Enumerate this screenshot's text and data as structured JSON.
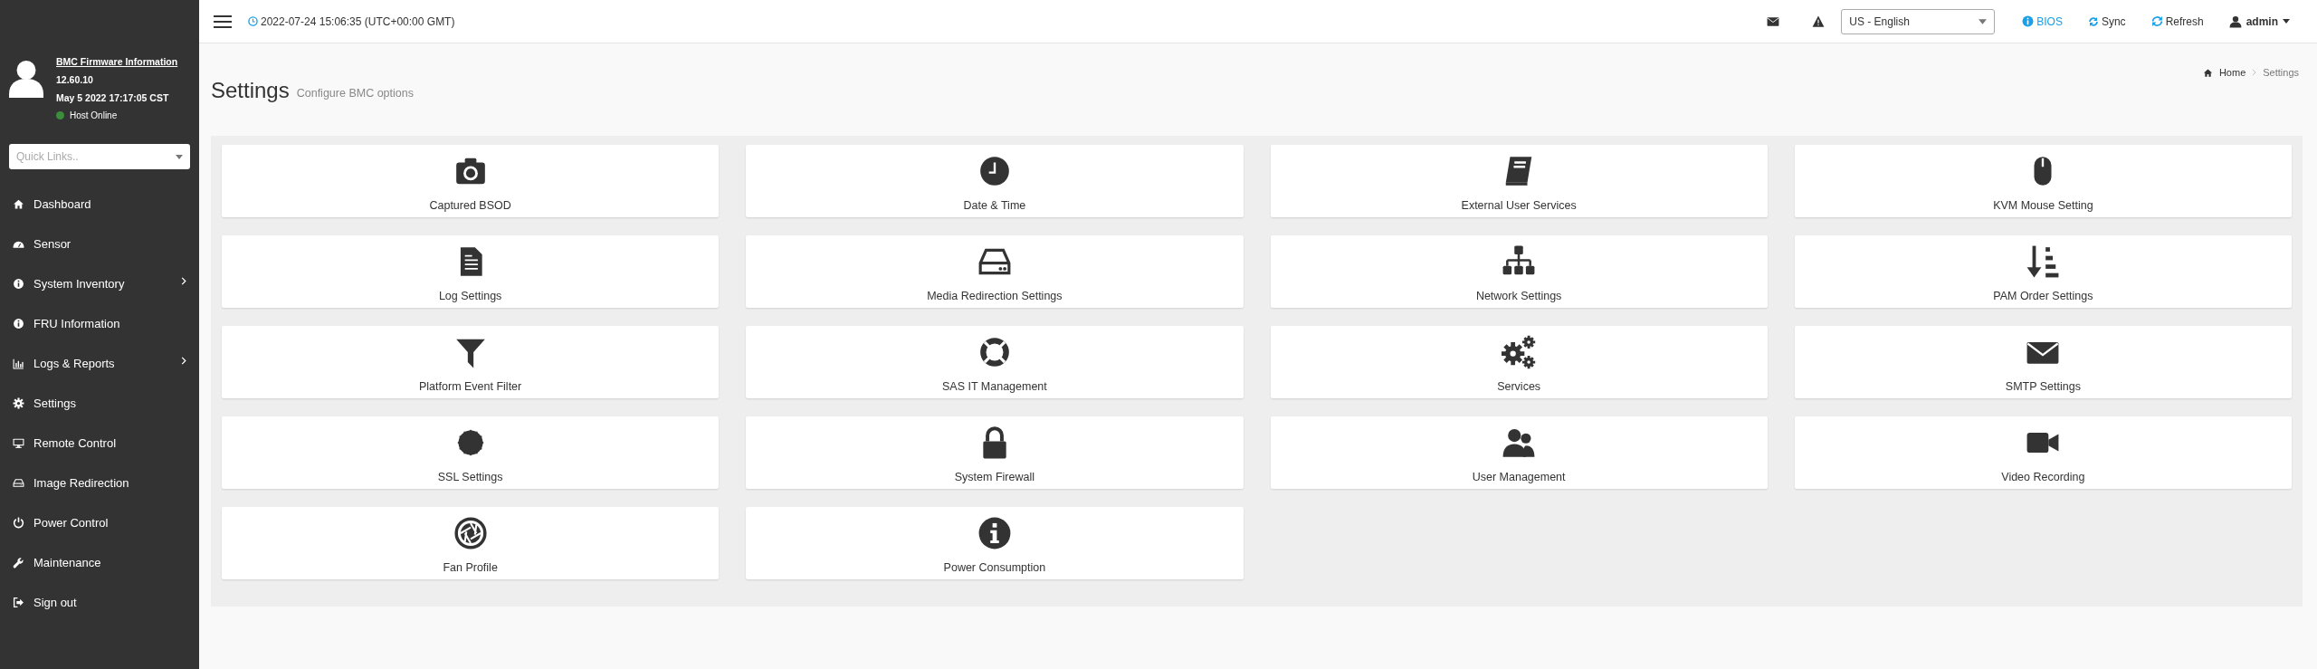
{
  "sidebar": {
    "firmware_link": "BMC Firmware Information",
    "version": "12.60.10",
    "build_date": "May 5 2022 17:17:05 CST",
    "host_status": {
      "label": "Host Online",
      "online": true
    },
    "quick_links": {
      "placeholder": "Quick Links.."
    },
    "items": [
      {
        "label": "Dashboard",
        "has_submenu": false
      },
      {
        "label": "Sensor",
        "has_submenu": false
      },
      {
        "label": "System Inventory",
        "has_submenu": true
      },
      {
        "label": "FRU Information",
        "has_submenu": false
      },
      {
        "label": "Logs & Reports",
        "has_submenu": true
      },
      {
        "label": "Settings",
        "has_submenu": false
      },
      {
        "label": "Remote Control",
        "has_submenu": false
      },
      {
        "label": "Image Redirection",
        "has_submenu": false
      },
      {
        "label": "Power Control",
        "has_submenu": false
      },
      {
        "label": "Maintenance",
        "has_submenu": false
      },
      {
        "label": "Sign out",
        "has_submenu": false
      }
    ]
  },
  "topbar": {
    "datetime": "2022-07-24 15:06:35 (UTC+00:00 GMT)",
    "language": "US - English",
    "bios": "BIOS",
    "sync": "Sync",
    "refresh": "Refresh",
    "user": "admin"
  },
  "page": {
    "title": "Settings",
    "subtitle": "Configure BMC options",
    "breadcrumb": [
      "Home",
      "Settings"
    ]
  },
  "cards": [
    {
      "label": "Captured BSOD"
    },
    {
      "label": "Date & Time"
    },
    {
      "label": "External User Services"
    },
    {
      "label": "KVM Mouse Setting"
    },
    {
      "label": "Log Settings"
    },
    {
      "label": "Media Redirection Settings"
    },
    {
      "label": "Network Settings"
    },
    {
      "label": "PAM Order Settings"
    },
    {
      "label": "Platform Event Filter"
    },
    {
      "label": "SAS IT Management"
    },
    {
      "label": "Services"
    },
    {
      "label": "SMTP Settings"
    },
    {
      "label": "SSL Settings"
    },
    {
      "label": "System Firewall"
    },
    {
      "label": "User Management"
    },
    {
      "label": "Video Recording"
    },
    {
      "label": "Fan Profile"
    },
    {
      "label": "Power Consumption"
    }
  ]
}
